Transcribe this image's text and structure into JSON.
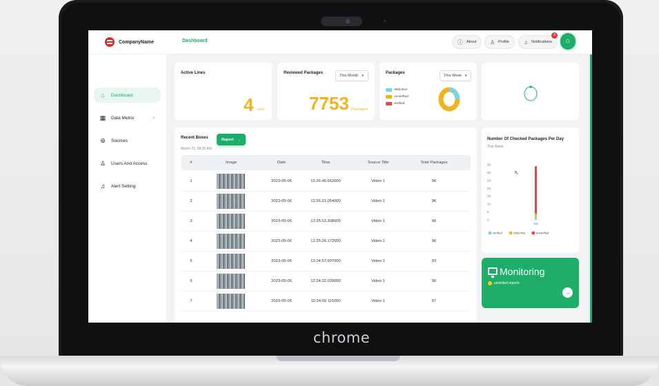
{
  "device": {
    "brand": "chrome"
  },
  "app": {
    "logo_text": "CompanyName",
    "breadcrumb": "Dashboard",
    "top_buttons": {
      "about": "About",
      "profile": "Profile",
      "notifications": "Notifications"
    },
    "notification_count": "4"
  },
  "sidebar": {
    "items": [
      {
        "label": "Dashboard",
        "icon": "home-icon"
      },
      {
        "label": "Data Metrix",
        "icon": "grid-icon"
      },
      {
        "label": "Sources",
        "icon": "source-icon"
      },
      {
        "label": "Users And Access",
        "icon": "user-icon"
      },
      {
        "label": "Alert Setting",
        "icon": "bell-icon"
      }
    ]
  },
  "cards": {
    "active_lines": {
      "title": "Active Lines",
      "value": "4",
      "unit": "Line"
    },
    "reviewed": {
      "title": "Reviewed Packages",
      "filter": "This Month",
      "value": "7753",
      "unit": "Packages"
    },
    "packages": {
      "title": "Packages",
      "filter": "This Week",
      "legend": [
        "defective",
        "unverified",
        "verified"
      ]
    }
  },
  "recent": {
    "title": "Recent Boxes",
    "report_label": "Report",
    "date": "March 23, 08:35 AM",
    "columns": [
      "#",
      "Image",
      "Date",
      "Time",
      "Source Title",
      "Total Packages"
    ],
    "rows": [
      [
        "1",
        "2023-05-06",
        "12:26:46.662000",
        "Video 1",
        "96"
      ],
      [
        "2",
        "2023-05-06",
        "12:26:21.054000",
        "Video 1",
        "96"
      ],
      [
        "3",
        "2023-05-06",
        "12:25:53.308000",
        "Video 1",
        "96"
      ],
      [
        "4",
        "2023-05-06",
        "12:25:26.172000",
        "Video 1",
        "96"
      ],
      [
        "5",
        "2023-05-06",
        "12:24:57.937000",
        "Video 1",
        "93"
      ],
      [
        "6",
        "2023-05-06",
        "12:24:32.039000",
        "Video 1",
        "96"
      ],
      [
        "7",
        "2023-05-06",
        "12:24:02.115000",
        "Video 1",
        "97"
      ]
    ]
  },
  "checked_chart": {
    "title": "Number Of Checked Packages Per Day",
    "subtitle": "This Week"
  },
  "monitoring": {
    "title": "Monitoring",
    "subtitle": "unvisited reports"
  },
  "colors": {
    "accent": "#1fae6a",
    "defective": "#7dd3e0",
    "unverified": "#f2b41b",
    "verified": "#e04848"
  },
  "chart_data": [
    {
      "type": "pie",
      "categories": [
        "defective",
        "unverified",
        "verified"
      ],
      "values": [
        25,
        75,
        0
      ],
      "colors": [
        "#7dd3e0",
        "#f2b41b",
        "#e04848"
      ]
    },
    {
      "type": "bar",
      "categories": [
        "Sat"
      ],
      "series": [
        {
          "name": "verified",
          "values": [
            2
          ]
        },
        {
          "name": "defective",
          "values": [
            2
          ]
        },
        {
          "name": "unverified",
          "values": [
            30
          ]
        }
      ],
      "yticks": [
        0,
        5,
        10,
        15,
        20,
        25,
        30,
        35
      ],
      "ylim": [
        0,
        35
      ],
      "legend": "bottom"
    }
  ]
}
